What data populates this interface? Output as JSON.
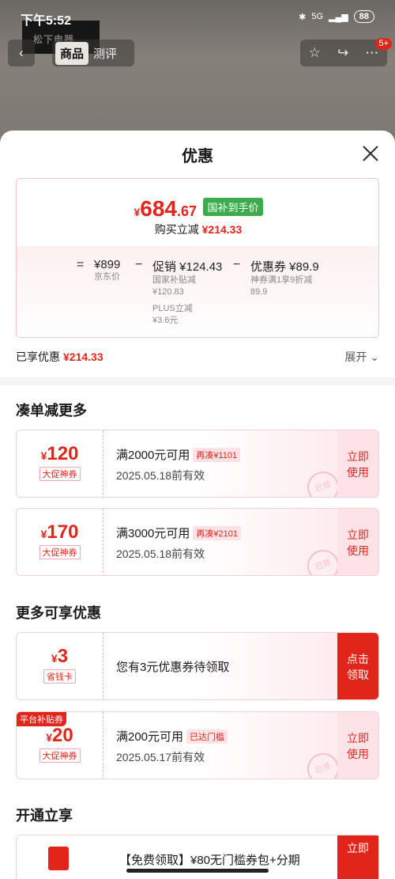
{
  "status": {
    "time": "下午5:52",
    "signal": "5G",
    "battery": "88"
  },
  "header": {
    "logo_text": "松下电器",
    "tabs": [
      "商品",
      "测评"
    ],
    "notif_count": "5+"
  },
  "sheet": {
    "title": "优惠"
  },
  "price": {
    "currency": "¥",
    "int": "684",
    "dec": ".67",
    "tag": "国补到手价",
    "reduce_label": "购买立减",
    "reduce_value": "¥214.33",
    "eq": "=",
    "jd_value": "¥899",
    "jd_label": "京东价",
    "minus1": "−",
    "promo_value": "促销 ¥124.43",
    "promo_sub1": "国家补贴减",
    "promo_sub1_val": "¥120.83",
    "promo_sub2": "PLUS立减",
    "promo_sub2_val": "¥3.6元",
    "minus2": "−",
    "coupon_value": "优惠券 ¥89.9",
    "coupon_sub": "神券满1享9折减",
    "coupon_sub_val": "89.9"
  },
  "applied": {
    "label": "已享优惠",
    "value": "¥214.33",
    "expand": "展开"
  },
  "section1": {
    "title": "凑单减更多"
  },
  "coupons": [
    {
      "currency": "¥",
      "amount": "120",
      "tag": "大促神券",
      "title": "满2000元可用",
      "extra": "再凑¥1101",
      "date": "2025.05.18前有效",
      "action": "立即使用",
      "stamp": "已领"
    },
    {
      "currency": "¥",
      "amount": "170",
      "tag": "大促神券",
      "title": "满3000元可用",
      "extra": "再凑¥2101",
      "date": "2025.05.18前有效",
      "action": "立即使用",
      "stamp": "已领"
    }
  ],
  "section2": {
    "title": "更多可享优惠"
  },
  "more": [
    {
      "currency": "¥",
      "amount": "3",
      "tag": "省钱卡",
      "title": "您有3元优惠券待领取",
      "action": "点击领取"
    },
    {
      "platform": "平台补贴券",
      "currency": "¥",
      "amount": "20",
      "tag": "大促神券",
      "title": "满200元可用",
      "extra": "已达门槛",
      "date": "2025.05.17前有效",
      "action": "立即使用",
      "stamp": "已领"
    }
  ],
  "section3": {
    "title": "开通立享"
  },
  "bottom": {
    "title": "【免费领取】¥80无门槛券包+分期",
    "action": "立即"
  }
}
